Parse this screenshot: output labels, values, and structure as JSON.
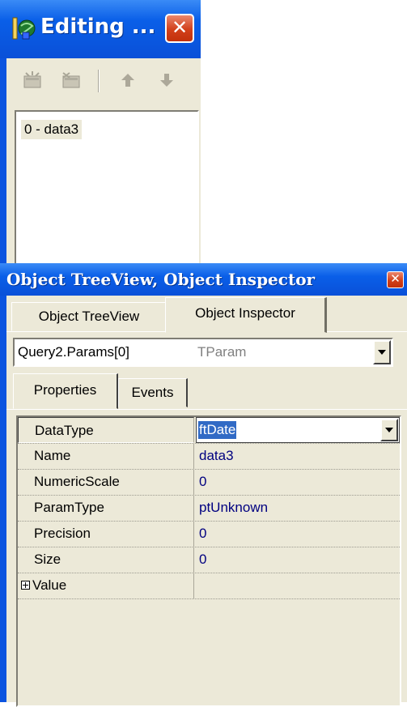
{
  "editing_window": {
    "title": "Editing ...",
    "title_icon": "delphi-icon",
    "close_icon": "close-icon",
    "close_glyph": "✕",
    "toolbar": {
      "add_icon": "add-param-icon",
      "delete_icon": "delete-param-icon",
      "move_up_icon": "arrow-up-icon",
      "move_down_icon": "arrow-down-icon"
    },
    "list_items": [
      "0 - data3"
    ]
  },
  "inspector_window": {
    "title": "Object TreeView, Object Inspector",
    "close_glyph": "✕",
    "top_tabs": [
      {
        "label": "Object TreeView"
      },
      {
        "label": "Object Inspector"
      }
    ],
    "active_top_tab": "Object Inspector",
    "object_selector": {
      "name": "Query2.Params[0]",
      "type": "TParam"
    },
    "sub_tabs": [
      {
        "label": "Properties"
      },
      {
        "label": "Events"
      }
    ],
    "active_sub_tab": "Properties",
    "properties": [
      {
        "name": "DataType",
        "value": "ftDate",
        "selected": true
      },
      {
        "name": "Name",
        "value": "data3"
      },
      {
        "name": "NumericScale",
        "value": "0"
      },
      {
        "name": "ParamType",
        "value": "ptUnknown"
      },
      {
        "name": "Precision",
        "value": "0"
      },
      {
        "name": "Size",
        "value": "0"
      },
      {
        "name": "Value",
        "value": "",
        "expandable": true
      }
    ]
  },
  "colors": {
    "title_bar_blue": "#0a5fe8",
    "window_face": "#ece9d8",
    "value_text": "#000080",
    "selection": "#316ac5",
    "close_red": "#d2401a"
  }
}
